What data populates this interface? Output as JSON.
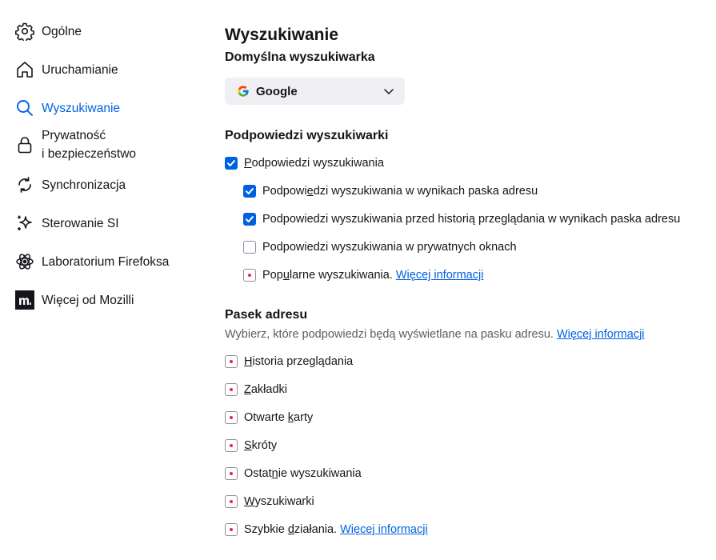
{
  "sidebar": {
    "items": [
      {
        "label": "Ogólne",
        "icon": "gear-icon"
      },
      {
        "label": "Uruchamianie",
        "icon": "home-icon"
      },
      {
        "label": "Wyszukiwanie",
        "icon": "search-icon",
        "active": true
      },
      {
        "label": "Prywatność",
        "label2": "i bezpieczeństwo",
        "icon": "lock-icon"
      },
      {
        "label": "Synchronizacja",
        "icon": "sync-icon"
      },
      {
        "label": "Sterowanie SI",
        "icon": "sparkle-icon"
      },
      {
        "label": "Laboratorium Firefoksa",
        "icon": "atom-icon"
      },
      {
        "label": "Więcej od Mozilli",
        "icon": "mozilla-icon"
      }
    ]
  },
  "main": {
    "title": "Wyszukiwanie",
    "default_engine": {
      "heading": "Domyślna wyszukiwarka",
      "selected": "Google"
    },
    "suggestions": {
      "heading": "Podpowiedzi wyszukiwarki",
      "main_checkbox": {
        "pre": "",
        "accel": "P",
        "post": "odpowiedzi wyszukiwania",
        "state": "checked"
      },
      "sub_items": [
        {
          "pre": "Podpowi",
          "accel": "e",
          "post": "dzi wyszukiwania w wynikach paska adresu",
          "state": "checked"
        },
        {
          "pre": "Podpowiedzi wyszukiwania przed historią przeglądania w wynikach paska adresu",
          "accel": "",
          "post": "",
          "state": "checked"
        },
        {
          "pre": "Podpowiedzi wyszukiwania w prywatnych oknach",
          "accel": "",
          "post": "",
          "state": "unchecked"
        },
        {
          "pre": "Pop",
          "accel": "u",
          "post": "larne wyszukiwania.",
          "state": "dot",
          "link": "Więcej informacji"
        }
      ]
    },
    "address_bar": {
      "heading": "Pasek adresu",
      "description": "Wybierz, które podpowiedzi będą wyświetlane na pasku adresu.",
      "description_link": "Więcej informacji",
      "items": [
        {
          "pre": "",
          "accel": "H",
          "post": "istoria przeglądania",
          "state": "dot"
        },
        {
          "pre": "",
          "accel": "Z",
          "post": "akładki",
          "state": "dot"
        },
        {
          "pre": "Otwarte ",
          "accel": "k",
          "post": "arty",
          "state": "dot"
        },
        {
          "pre": "",
          "accel": "S",
          "post": "króty",
          "state": "dot"
        },
        {
          "pre": "Ostat",
          "accel": "n",
          "post": "ie wyszukiwania",
          "state": "dot"
        },
        {
          "pre": "",
          "accel": "W",
          "post": "yszukiwarki",
          "state": "dot"
        },
        {
          "pre": "Szybkie ",
          "accel": "d",
          "post": "ziałania.",
          "state": "dot",
          "link": "Więcej informacji"
        }
      ]
    }
  },
  "colors": {
    "accent": "#0061e0",
    "text": "#15141a",
    "muted": "#5b5b66",
    "dot": "#e22850"
  }
}
